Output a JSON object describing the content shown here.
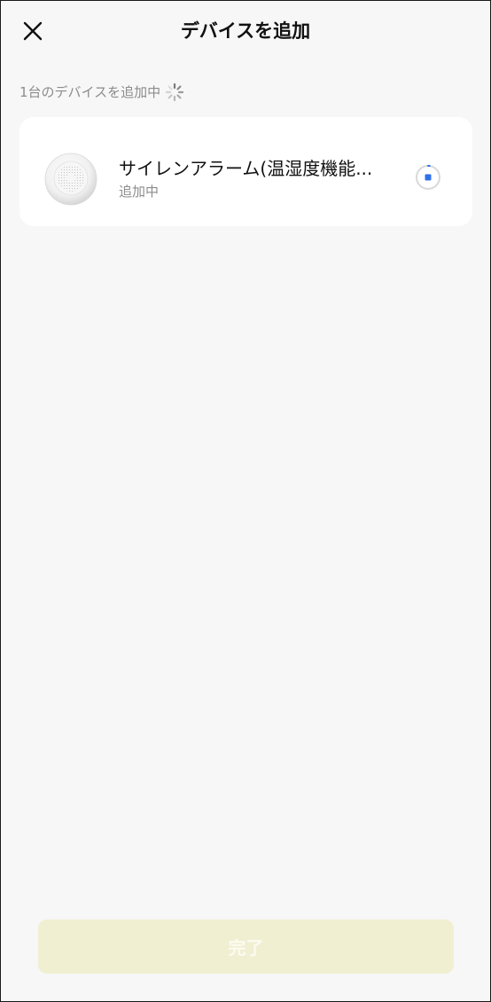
{
  "header": {
    "title": "デバイスを追加",
    "close_icon": "close-icon"
  },
  "status": {
    "text": "1台のデバイスを追加中",
    "icon": "loading-spinner-icon"
  },
  "devices": [
    {
      "name": "サイレンアラーム(温湿度機能...",
      "status": "追加中",
      "image": "siren-alarm-device-image",
      "status_icon": "progress-stop-icon"
    }
  ],
  "footer": {
    "done_label": "完了",
    "done_enabled": false
  },
  "colors": {
    "background": "#f7f7f7",
    "card": "#ffffff",
    "text_primary": "#111111",
    "text_secondary": "#8c8c8c",
    "accent_blue": "#2f6fe8",
    "button_disabled_bg": "#f0efd2",
    "button_disabled_text": "#fbfbf0"
  }
}
